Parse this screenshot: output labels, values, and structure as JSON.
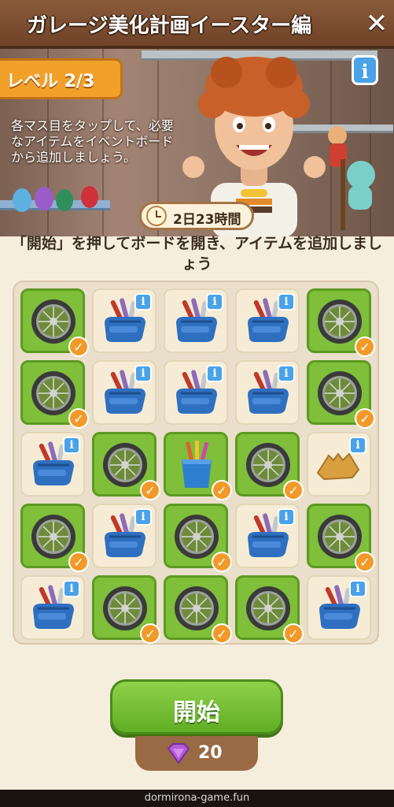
{
  "header": {
    "title": "ガレージ美化計画イースター編",
    "close_label": "✕"
  },
  "level": {
    "label": "レベル 2/3"
  },
  "description": "各マス目をタップして、必要なアイテムをイベントボードから追加しましょう。",
  "timer": {
    "text": "2日23時間"
  },
  "instruction": "「開始」を押してボードを開き、アイテムを追加しましょう",
  "board": {
    "rows": [
      [
        {
          "item": "wheel",
          "done": true
        },
        {
          "item": "toolkit",
          "done": false
        },
        {
          "item": "toolkit",
          "done": false
        },
        {
          "item": "toolkit",
          "done": false
        },
        {
          "item": "wheel",
          "done": true
        }
      ],
      [
        {
          "item": "wheel",
          "done": true
        },
        {
          "item": "toolkit",
          "done": false
        },
        {
          "item": "toolkit",
          "done": false
        },
        {
          "item": "toolkit",
          "done": false
        },
        {
          "item": "wheel",
          "done": true
        }
      ],
      [
        {
          "item": "toolkit",
          "done": false
        },
        {
          "item": "wheel",
          "done": true
        },
        {
          "item": "pencil-cup",
          "done": true
        },
        {
          "item": "wheel",
          "done": true
        },
        {
          "item": "cloth",
          "done": false
        }
      ],
      [
        {
          "item": "wheel",
          "done": true
        },
        {
          "item": "toolkit",
          "done": false
        },
        {
          "item": "wheel",
          "done": true
        },
        {
          "item": "toolkit",
          "done": false
        },
        {
          "item": "wheel",
          "done": true
        }
      ],
      [
        {
          "item": "toolkit",
          "done": false
        },
        {
          "item": "wheel",
          "done": true
        },
        {
          "item": "wheel",
          "done": true
        },
        {
          "item": "wheel",
          "done": true
        },
        {
          "item": "toolkit",
          "done": false
        }
      ]
    ]
  },
  "start_button": {
    "label": "開始"
  },
  "cost": {
    "amount": "20",
    "icon": "gem-icon"
  },
  "footer": {
    "text": "dormirona-game.fun"
  },
  "colors": {
    "done_cell": "#7fbf3a",
    "check": "#f19a2a",
    "info": "#4aa2e8",
    "start": "#6cbd2c"
  }
}
